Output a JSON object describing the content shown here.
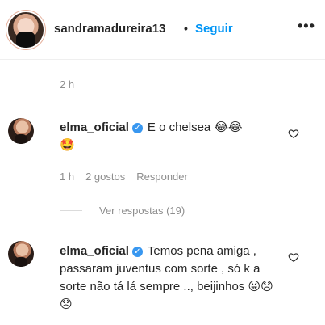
{
  "header": {
    "username": "sandramadureira13",
    "separator": "•",
    "follow_label": "Seguir",
    "more_label": "•••"
  },
  "post": {
    "time": "2 h"
  },
  "comments": [
    {
      "username": "elma_oficial",
      "verified": "✓",
      "text": "E o chelsea 😂😂",
      "text2": "🤩",
      "time": "1 h",
      "likes": "2 gostos",
      "reply_label": "Responder"
    },
    {
      "username": "elma_oficial",
      "verified": "✓",
      "text": "Temos pena amiga , passaram juventus com sorte , só k a sorte não tá lá sempre .., beijinhos 😜😞😞"
    }
  ],
  "view_replies_label": "Ver respostas (19)"
}
